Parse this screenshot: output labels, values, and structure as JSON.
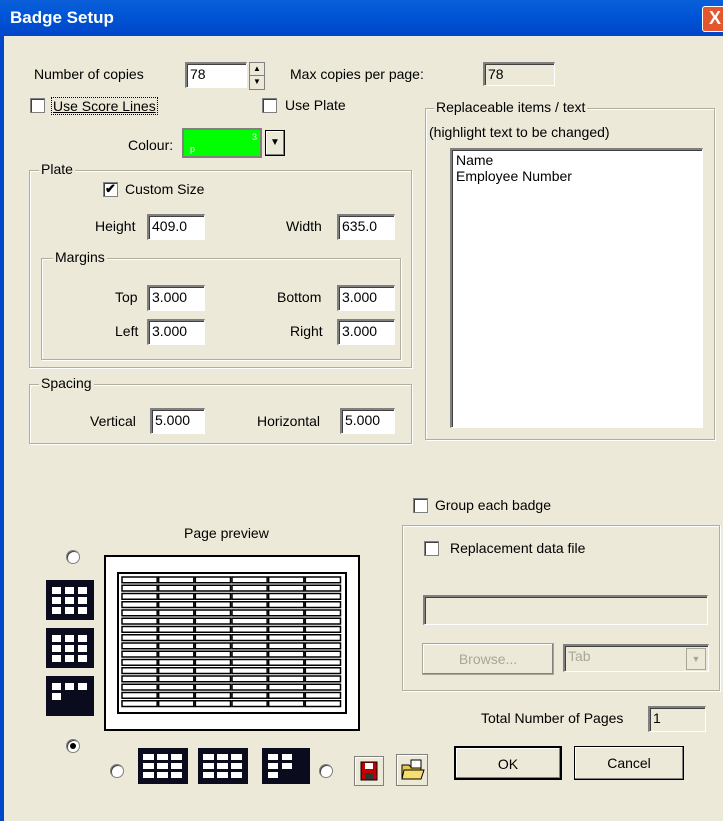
{
  "window": {
    "title": "Badge Setup",
    "close_glyph": "X"
  },
  "copies": {
    "label": "Number of copies",
    "value": "78",
    "max_label": "Max copies per page:",
    "max_value": "78"
  },
  "options": {
    "score_lines_label": "Use Score Lines",
    "score_lines_checked": false,
    "use_plate_label": "Use Plate",
    "use_plate_checked": false,
    "colour_label": "Colour:",
    "colour_value": "#00ff00"
  },
  "plate": {
    "group_label": "Plate",
    "custom_size_label": "Custom Size",
    "custom_size_checked": true,
    "height_label": "Height",
    "height_value": "409.0",
    "width_label": "Width",
    "width_value": "635.0"
  },
  "margins": {
    "group_label": "Margins",
    "top_label": "Top",
    "top_value": "3.000",
    "bottom_label": "Bottom",
    "bottom_value": "3.000",
    "left_label": "Left",
    "left_value": "3.000",
    "right_label": "Right",
    "right_value": "3.000"
  },
  "spacing": {
    "group_label": "Spacing",
    "vertical_label": "Vertical",
    "vertical_value": "5.000",
    "horizontal_label": "Horizontal",
    "horizontal_value": "5.000"
  },
  "replaceable": {
    "group_label": "Replaceable items / text",
    "hint": "(highlight text to be changed)",
    "items": [
      "Name",
      "Employee Number"
    ]
  },
  "group_each_badge": {
    "label": "Group each badge",
    "checked": false
  },
  "replacement": {
    "label": "Replacement data file",
    "checked": false,
    "file_value": "",
    "browse_label": "Browse...",
    "delimiter_value": "Tab"
  },
  "preview": {
    "label": "Page preview",
    "rows": 16,
    "cols": 6
  },
  "total_pages": {
    "label": "Total Number of Pages",
    "value": "1"
  },
  "buttons": {
    "ok_label": "OK",
    "cancel_label": "Cancel"
  },
  "icons": {
    "save": "save-disk-icon",
    "open": "open-folder-icon"
  }
}
